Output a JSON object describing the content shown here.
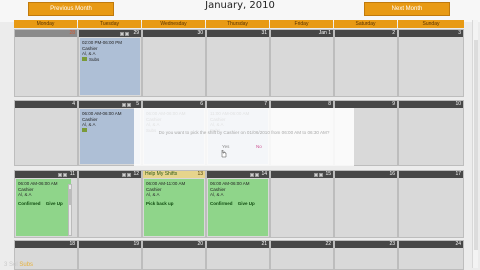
{
  "header": {
    "title": "January, 2010",
    "prev_label": "Previous Month",
    "next_label": "Next Month"
  },
  "weekdays": [
    "Monday",
    "Tuesday",
    "Wednesday",
    "Thursday",
    "Friday",
    "Saturday",
    "Sunday"
  ],
  "weeks": [
    {
      "days": [
        "28",
        "29",
        "30",
        "31",
        "Jan 1",
        "2",
        "3"
      ]
    },
    {
      "days": [
        "4",
        "5",
        "6",
        "7",
        "8",
        "9",
        "10"
      ]
    },
    {
      "days": [
        "11",
        "12",
        "13",
        "14",
        "15",
        "16",
        "17"
      ]
    },
    {
      "days": [
        "18",
        "19",
        "20",
        "21",
        "22",
        "23",
        "24"
      ]
    }
  ],
  "shifts": {
    "dec29": {
      "time": "02:00 PM-06:00 PM",
      "role": "Cashier",
      "person": "Al, & A",
      "status": "Subs"
    },
    "jan5": {
      "time": "06:00 AM-06:00 AM",
      "role": "Cashier",
      "person": "Al, & A"
    },
    "jan6": {
      "time": "06:00 AM-06:00 AM",
      "role": "Cashier",
      "person": "Al, & A",
      "status": "Subs"
    },
    "jan7": {
      "time": "11:00 AM-06:00 AM",
      "role": "Cashier",
      "person": "Al, & A",
      "status": "Subs"
    },
    "jan11": {
      "time": "06:00 AM-06:00 AM",
      "role": "Cashier",
      "person": "Al, & A",
      "action1": "Confirmed",
      "action2": "Give Up"
    },
    "jan13": {
      "title": "Help My Shifts",
      "time": "06:00 AM-11:00 AM",
      "role": "Cashier",
      "person": "Al, & A",
      "action": "Pick back up"
    },
    "jan14": {
      "time": "06:00 AM-06:00 AM",
      "role": "Cashier",
      "person": "Al, & A",
      "action1": "Confirmed",
      "action2": "Give Up"
    }
  },
  "dialog": {
    "message": "Do you want to pick the shift by Cashier on 01/06/2010 from 06:00 AM to 06:30 AM?",
    "yes": "Yes",
    "no": "No"
  },
  "watermark": {
    "part1": "3 Sol",
    "part2": "Subs"
  },
  "colors": {
    "accent": "#e89a14",
    "header_dark": "#474747",
    "shift_blue": "#aebfd6",
    "shift_green": "#8fd58a"
  }
}
